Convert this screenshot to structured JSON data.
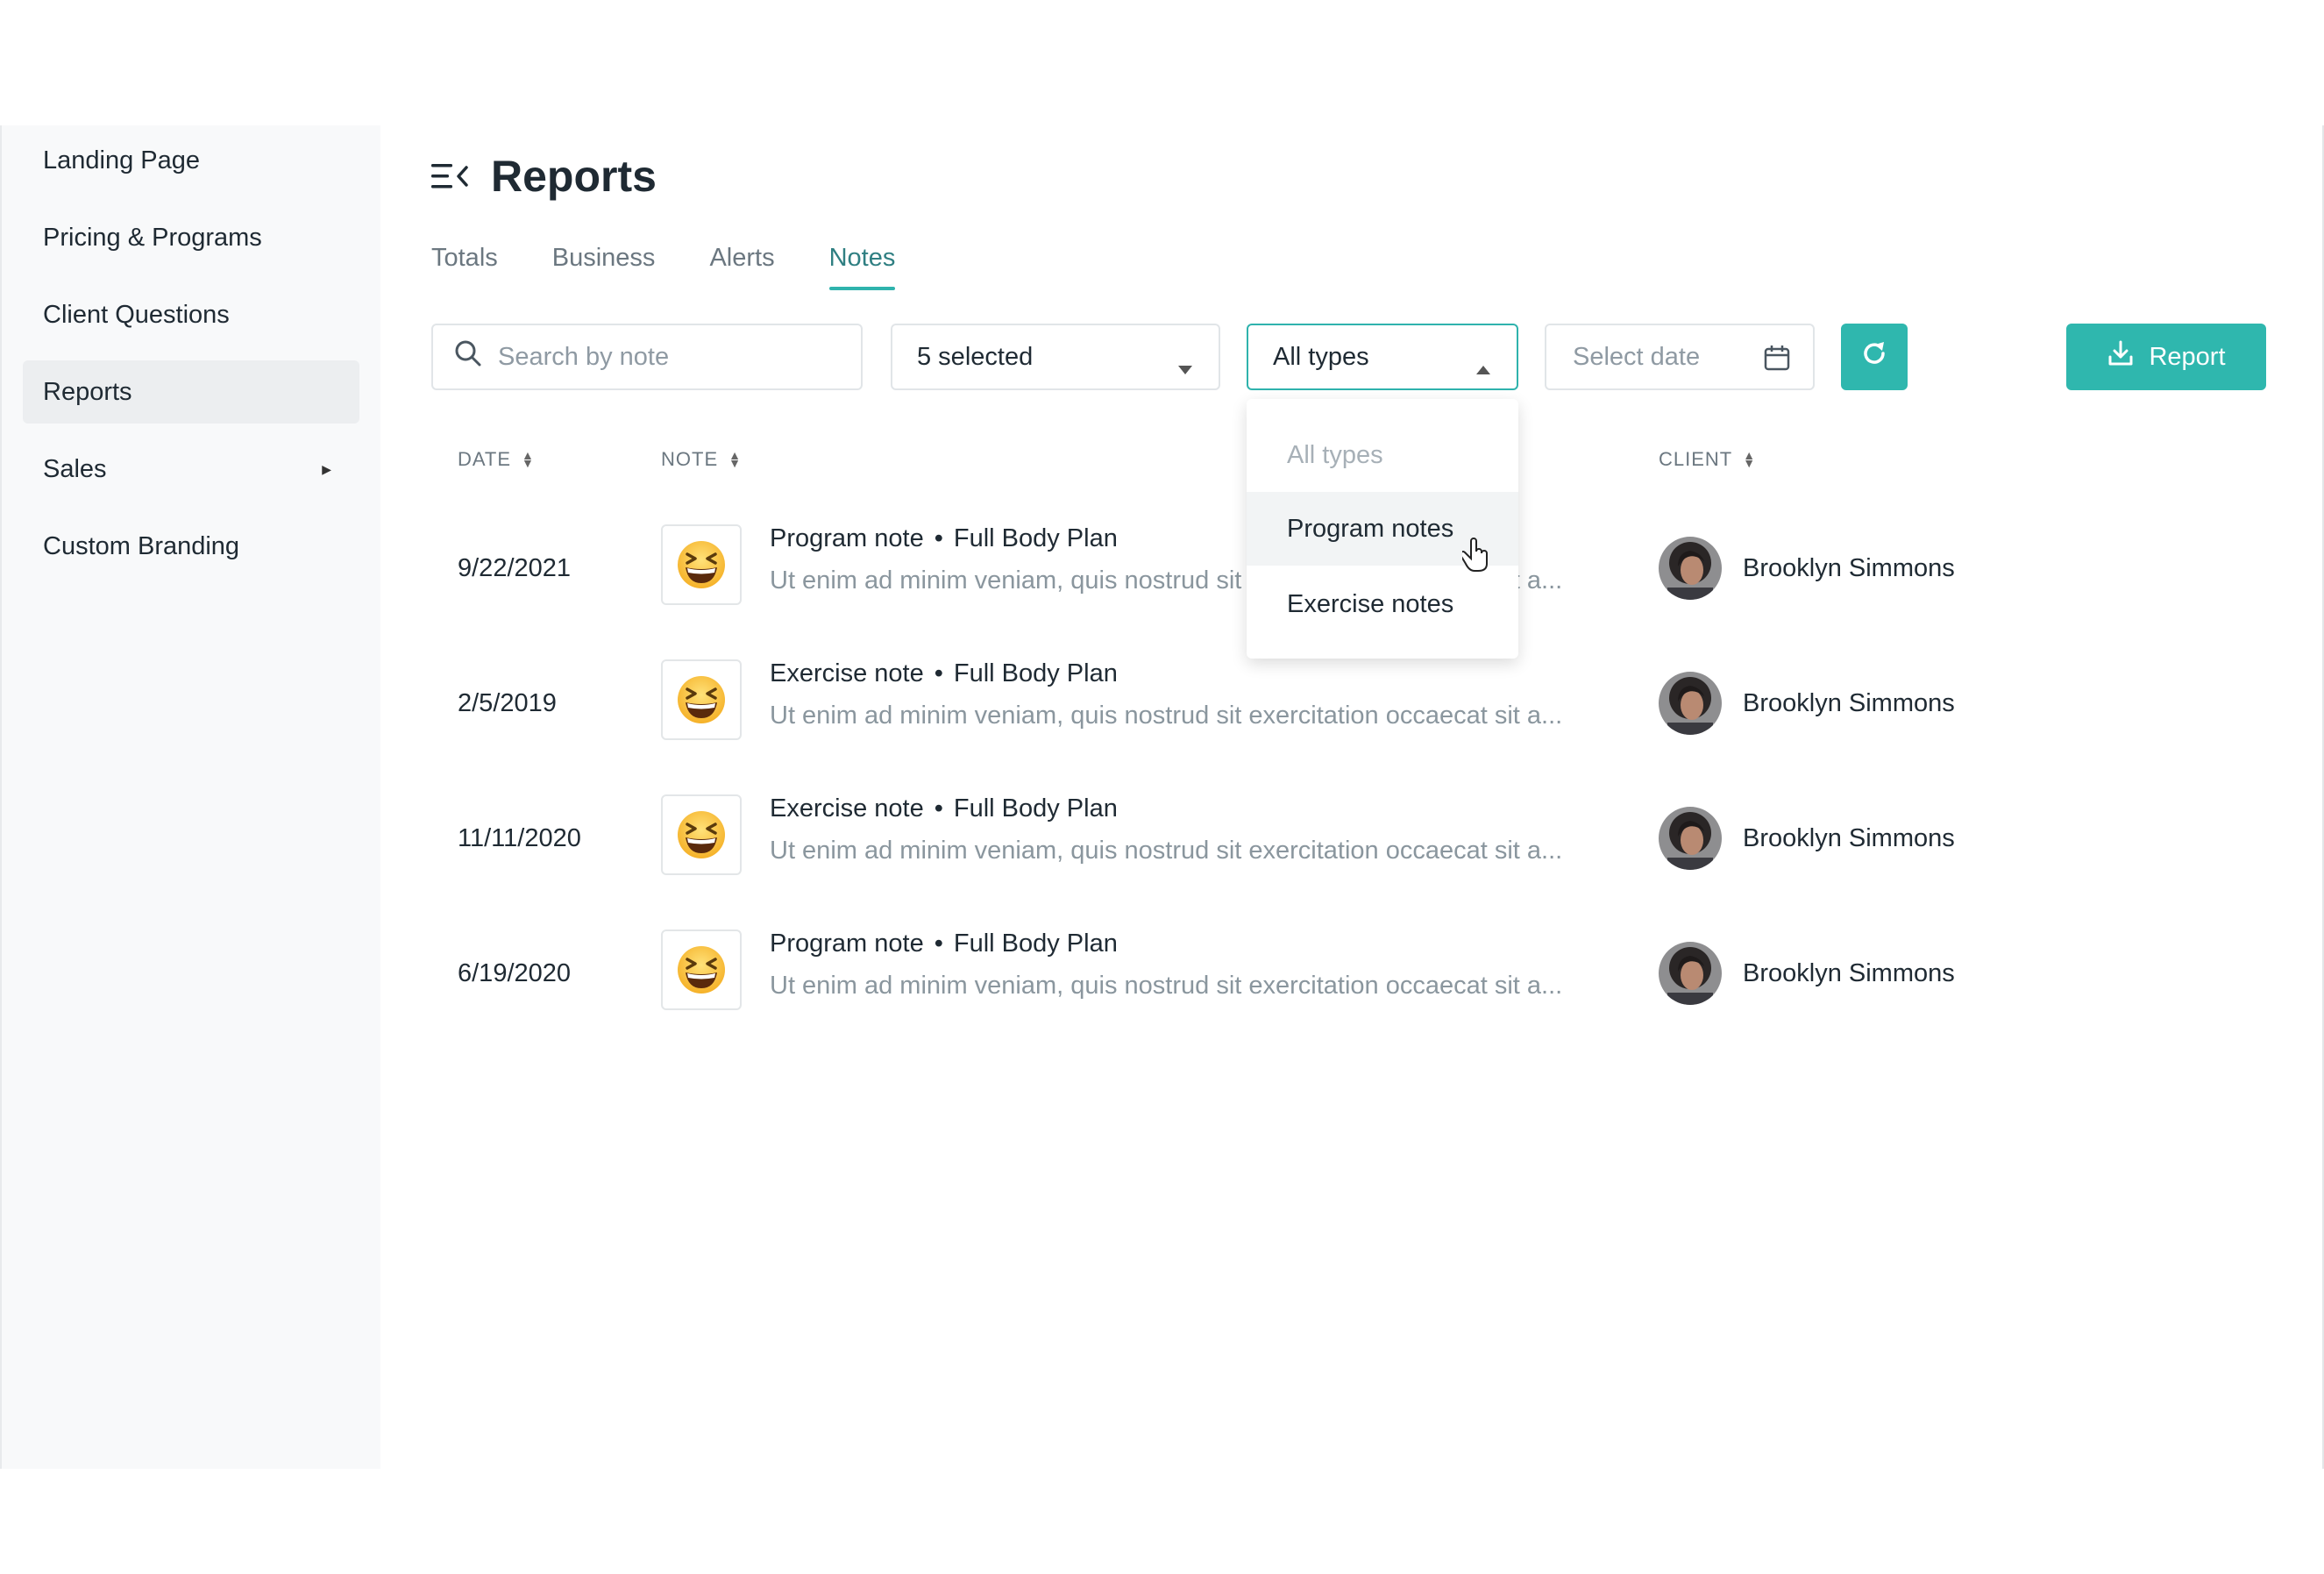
{
  "sidebar": {
    "items": [
      {
        "label": "Landing Page"
      },
      {
        "label": "Pricing & Programs"
      },
      {
        "label": "Client Questions"
      },
      {
        "label": "Reports",
        "active": true
      },
      {
        "label": "Sales",
        "has_submenu": true
      },
      {
        "label": "Custom Branding"
      }
    ]
  },
  "header": {
    "title": "Reports"
  },
  "tabs": [
    {
      "label": "Totals"
    },
    {
      "label": "Business"
    },
    {
      "label": "Alerts"
    },
    {
      "label": "Notes",
      "active": true
    }
  ],
  "filters": {
    "search_placeholder": "Search by note",
    "selected_label": "5 selected",
    "type_value": "All types",
    "date_placeholder": "Select date",
    "report_label": "Report"
  },
  "type_dropdown": {
    "open": true,
    "options": [
      "All types",
      "Program notes",
      "Exercise notes"
    ],
    "hovered": "Program notes"
  },
  "table": {
    "columns": {
      "date": "DATE",
      "note": "NOTE",
      "client": "CLIENT"
    },
    "rows": [
      {
        "date": "9/22/2021",
        "type": "Program note",
        "plan": "Full Body Plan",
        "text": "Ut enim ad minim veniam, quis nostrud sit exercitation occaecat sit a...",
        "client": "Brooklyn Simmons"
      },
      {
        "date": "2/5/2019",
        "type": "Exercise note",
        "plan": "Full Body Plan",
        "text": "Ut enim ad minim veniam, quis nostrud sit exercitation occaecat sit a...",
        "client": "Brooklyn Simmons"
      },
      {
        "date": "11/11/2020",
        "type": "Exercise note",
        "plan": "Full Body Plan",
        "text": "Ut enim ad minim veniam, quis nostrud sit exercitation occaecat sit a...",
        "client": "Brooklyn Simmons"
      },
      {
        "date": "6/19/2020",
        "type": "Program note",
        "plan": "Full Body Plan",
        "text": "Ut enim ad minim veniam, quis nostrud sit exercitation occaecat sit a...",
        "client": "Brooklyn Simmons"
      }
    ],
    "dot_separator": "•"
  },
  "colors": {
    "accent": "#2fb7ae",
    "active_tab": "#2f7f82",
    "text": "#1f2a33",
    "muted": "#8a969e"
  },
  "icons": {
    "emoji": "grinning-squinting-face-icon",
    "avatar": "client-avatar"
  }
}
